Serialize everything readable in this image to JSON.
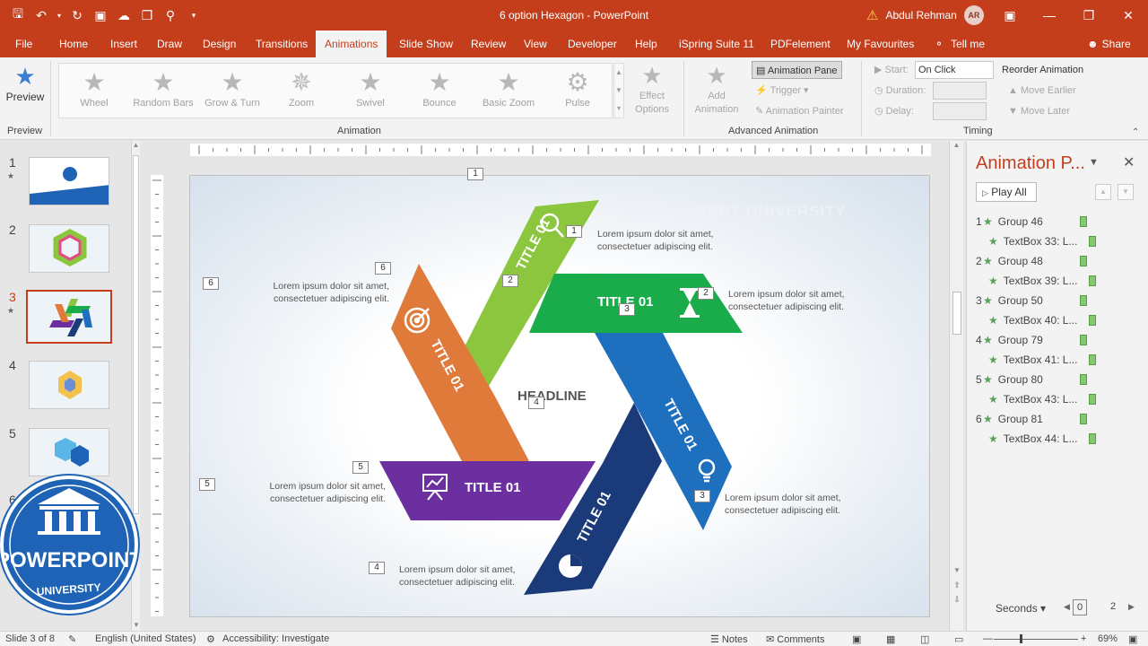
{
  "app": {
    "document_title": "6 option Hexagon  -  PowerPoint",
    "user_name": "Abdul Rehman",
    "user_initials": "AR"
  },
  "qat_icons": [
    "save-icon",
    "undo-icon",
    "redo-icon",
    "repeat-icon",
    "presenter-icon",
    "touch-icon",
    "print-preview-icon",
    "customize-icon"
  ],
  "tabs": [
    {
      "label": "File"
    },
    {
      "label": "Home"
    },
    {
      "label": "Insert"
    },
    {
      "label": "Draw"
    },
    {
      "label": "Design"
    },
    {
      "label": "Transitions"
    },
    {
      "label": "Animations"
    },
    {
      "label": "Slide Show"
    },
    {
      "label": "Review"
    },
    {
      "label": "View"
    },
    {
      "label": "Developer"
    },
    {
      "label": "Help"
    },
    {
      "label": "iSpring Suite 11"
    },
    {
      "label": "PDFelement"
    },
    {
      "label": "My Favourites"
    }
  ],
  "tell_me": "Tell me",
  "share": "Share",
  "ribbon": {
    "preview_label": "Preview",
    "preview_group": "Preview",
    "animation_group": "Animation",
    "animations": [
      {
        "label": "Wheel"
      },
      {
        "label": "Random Bars"
      },
      {
        "label": "Grow & Turn"
      },
      {
        "label": "Zoom"
      },
      {
        "label": "Swivel"
      },
      {
        "label": "Bounce"
      },
      {
        "label": "Basic Zoom"
      },
      {
        "label": "Pulse"
      }
    ],
    "effect_options_1": "Effect",
    "effect_options_2": "Options",
    "add_animation_1": "Add",
    "add_animation_2": "Animation",
    "advanced_group": "Advanced Animation",
    "animation_pane": "Animation Pane",
    "trigger": "Trigger",
    "animation_painter": "Animation Painter",
    "timing_group": "Timing",
    "start_label": "Start:",
    "start_value": "On Click",
    "duration_label": "Duration:",
    "delay_label": "Delay:",
    "reorder": "Reorder Animation",
    "move_earlier": "Move Earlier",
    "move_later": "Move Later"
  },
  "slides": [
    {
      "num": "1",
      "star": "★"
    },
    {
      "num": "2",
      "star": ""
    },
    {
      "num": "3",
      "star": "★"
    },
    {
      "num": "4",
      "star": ""
    },
    {
      "num": "5",
      "star": ""
    },
    {
      "num": "6",
      "star": ""
    }
  ],
  "logo": {
    "line1": "POWERPOINT",
    "line2": "UNIVERSITY"
  },
  "slide": {
    "headline": "HEADLINE",
    "watermark": "POWERPOINT UNIVERSITY",
    "title_text": "TITLE 01",
    "lorem_1": "Lorem ipsum dolor sit amet,",
    "lorem_2": "consectetuer adipiscing elit.",
    "tags": [
      "1",
      "1",
      "2",
      "2",
      "3",
      "3",
      "4",
      "4",
      "5",
      "5",
      "6",
      "6"
    ]
  },
  "pane": {
    "title": "Animation P...",
    "play_all": "Play All",
    "rows": [
      {
        "num": "1",
        "label": "Group 46"
      },
      {
        "num": "",
        "label": "TextBox 33: L..."
      },
      {
        "num": "2",
        "label": "Group 48"
      },
      {
        "num": "",
        "label": "TextBox 39: L..."
      },
      {
        "num": "3",
        "label": "Group 50"
      },
      {
        "num": "",
        "label": "TextBox 40: L..."
      },
      {
        "num": "4",
        "label": "Group 79"
      },
      {
        "num": "",
        "label": "TextBox 41: L..."
      },
      {
        "num": "5",
        "label": "Group 80"
      },
      {
        "num": "",
        "label": "TextBox 43: L..."
      },
      {
        "num": "6",
        "label": "Group 81"
      },
      {
        "num": "",
        "label": "TextBox 44: L..."
      }
    ],
    "seconds": "Seconds",
    "sec_start": "0",
    "sec_end": "2"
  },
  "status": {
    "slide_of": "Slide 3 of 8",
    "language": "English (United States)",
    "accessibility": "Accessibility: Investigate",
    "notes": "Notes",
    "comments": "Comments",
    "zoom": "69%"
  },
  "colors": {
    "accent": "#c43e1c",
    "green_light": "#8cc63f",
    "green": "#1aab4b",
    "blue": "#1f6fbf",
    "navy": "#1a3a7a",
    "purple": "#6c2fa0",
    "orange": "#e07a3a"
  }
}
